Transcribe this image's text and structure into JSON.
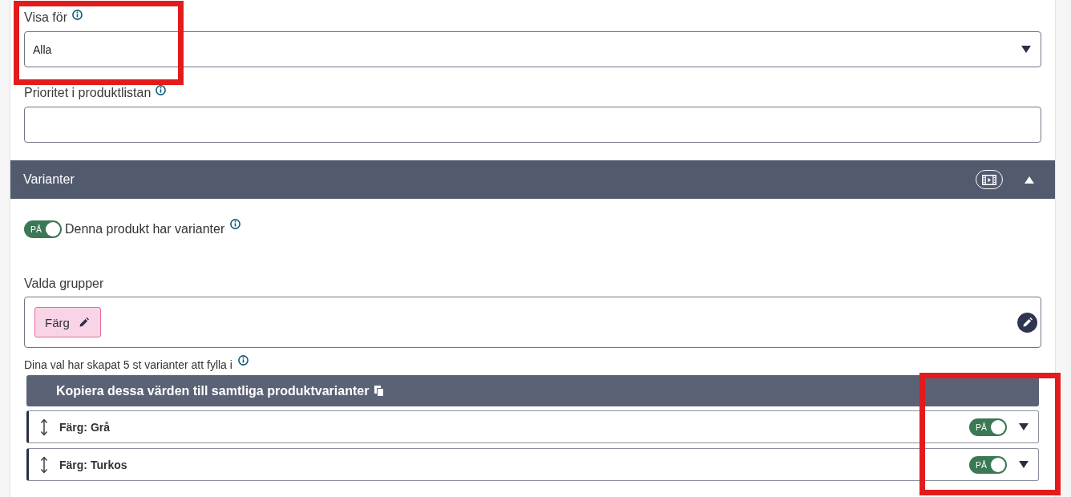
{
  "fields": [
    {
      "kind": "select",
      "label": "Visa för",
      "info": true,
      "value": "Alla",
      "highlighted": true
    },
    {
      "kind": "text",
      "label": "Prioritet i produktlistan",
      "info": true
    }
  ],
  "section": {
    "title": "Varianter",
    "expanded": true
  },
  "has_variants": {
    "toggle_label": "PÅ",
    "on": true,
    "label": "Denna produkt har varianter",
    "info": true
  },
  "groups": {
    "label": "Valda grupper",
    "chips": [
      {
        "label": "Färg"
      }
    ]
  },
  "variants": {
    "summary": "Dina val har skapat 5 st varianter att fylla i",
    "info": true,
    "copy_button": "Kopiera dessa värden till samtliga produktvarianter",
    "highlighted": true,
    "items": [
      {
        "label": "Färg: Grå",
        "toggle_label": "PÅ",
        "on": true,
        "expanded": false
      },
      {
        "label": "Färg: Turkos",
        "toggle_label": "PÅ",
        "on": true,
        "expanded": false
      }
    ]
  }
}
